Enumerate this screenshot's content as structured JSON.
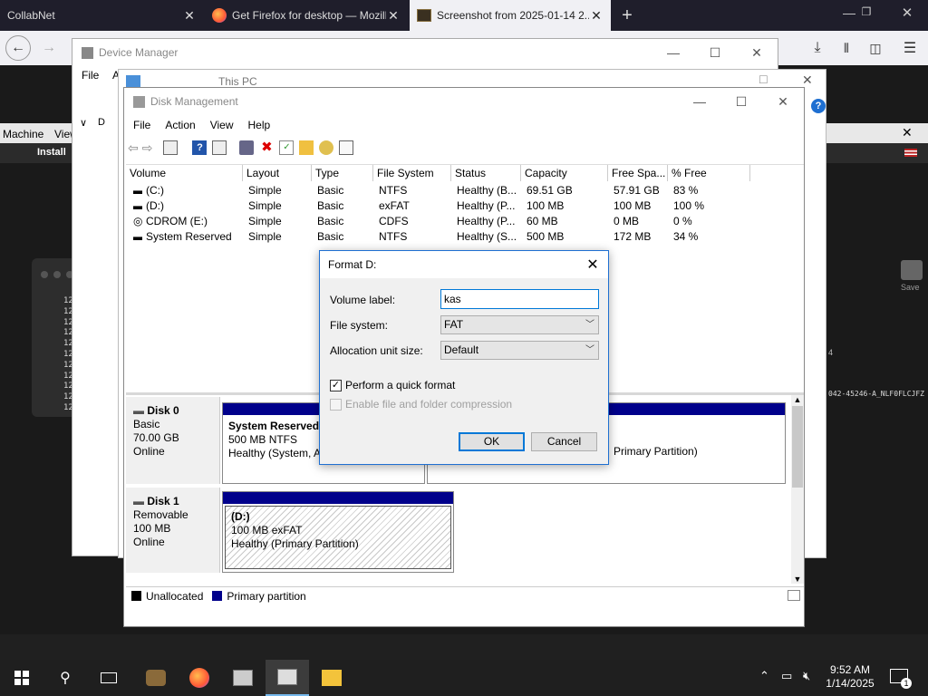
{
  "firefox": {
    "tabs": [
      {
        "title": "CollabNet",
        "close": "✕"
      },
      {
        "title": "Get Firefox for desktop — Mozilla",
        "close": "✕"
      },
      {
        "title": "Screenshot from 2025-01-14 2...",
        "close": "✕"
      }
    ],
    "new_tab": "+"
  },
  "vbox": {
    "menu": [
      "Machine",
      "View"
    ],
    "install_label": "Install",
    "save_label": "Save",
    "partial_id": "042-45246-A_NLF0FLCJFZ",
    "terminal_lines": [
      "12",
      "12",
      "12",
      "12",
      "12",
      "12",
      "12",
      "12",
      "12",
      "12",
      "12"
    ]
  },
  "device_manager": {
    "title": "Device Manager",
    "menu": [
      "File",
      "A"
    ]
  },
  "this_pc": {
    "label": "This PC"
  },
  "disk_mgmt": {
    "title": "Disk Management",
    "menu": [
      "File",
      "Action",
      "View",
      "Help"
    ],
    "columns": [
      "Volume",
      "Layout",
      "Type",
      "File System",
      "Status",
      "Capacity",
      "Free Spa...",
      "% Free"
    ],
    "volumes": [
      {
        "volume": "(C:)",
        "layout": "Simple",
        "type": "Basic",
        "fs": "NTFS",
        "status": "Healthy (B...",
        "capacity": "69.51 GB",
        "free": "57.91 GB",
        "pct": "83 %"
      },
      {
        "volume": "(D:)",
        "layout": "Simple",
        "type": "Basic",
        "fs": "exFAT",
        "status": "Healthy (P...",
        "capacity": "100 MB",
        "free": "100 MB",
        "pct": "100 %"
      },
      {
        "volume": "CDROM (E:)",
        "layout": "Simple",
        "type": "Basic",
        "fs": "CDFS",
        "status": "Healthy (P...",
        "capacity": "60 MB",
        "free": "0 MB",
        "pct": "0 %"
      },
      {
        "volume": "System Reserved",
        "layout": "Simple",
        "type": "Basic",
        "fs": "NTFS",
        "status": "Healthy (S...",
        "capacity": "500 MB",
        "free": "172 MB",
        "pct": "34 %"
      }
    ],
    "disk0": {
      "name": "Disk 0",
      "kind": "Basic",
      "size": "70.00 GB",
      "state": "Online",
      "p1_name": "System Reserved",
      "p1_info": "500 MB NTFS",
      "p1_status": "Healthy (System, Ac",
      "p2_status": "Primary Partition)"
    },
    "disk1": {
      "name": "Disk 1",
      "kind": "Removable",
      "size": "100 MB",
      "state": "Online",
      "p1_name": "(D:)",
      "p1_info": "100 MB exFAT",
      "p1_status": "Healthy (Primary Partition)"
    },
    "legend": {
      "unallocated": "Unallocated",
      "primary": "Primary partition"
    }
  },
  "format_dialog": {
    "title": "Format D:",
    "volume_label_label": "Volume label:",
    "volume_label_value": "kas",
    "file_system_label": "File system:",
    "file_system_value": "FAT",
    "alloc_label": "Allocation unit size:",
    "alloc_value": "Default",
    "quick_format_label": "Perform a quick format",
    "quick_format_checked": true,
    "compression_label": "Enable file and folder compression",
    "compression_checked": false,
    "ok": "OK",
    "cancel": "Cancel"
  },
  "taskbar": {
    "time": "9:52 AM",
    "date": "1/14/2025",
    "notif_count": "1"
  },
  "colors": {
    "accent": "#0078d7",
    "primary_partition": "#00008b"
  }
}
